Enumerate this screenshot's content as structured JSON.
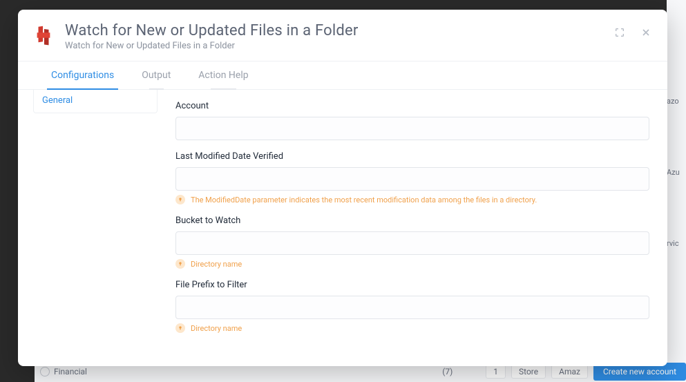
{
  "header": {
    "title": "Watch for New or Updated Files in a Folder",
    "subtitle": "Watch for New or Updated Files in a Folder"
  },
  "tabs": [
    {
      "label": "Configurations",
      "active": true
    },
    {
      "label": "Output",
      "active": false
    },
    {
      "label": "Action Help",
      "active": false
    }
  ],
  "sidebar": {
    "items": [
      {
        "label": "General"
      }
    ]
  },
  "form": {
    "account": {
      "label": "Account",
      "value": ""
    },
    "last_modified": {
      "label": "Last Modified Date Verified",
      "value": "",
      "hint": "The ModifiedDate parameter indicates the most recent modification data among the files in a directory."
    },
    "bucket": {
      "label": "Bucket to Watch",
      "value": "",
      "hint": "Directory name"
    },
    "prefix": {
      "label": "File Prefix to Filter",
      "value": "",
      "hint": "Directory name"
    }
  },
  "background": {
    "right_labels": [
      "azo",
      "Azu",
      "rvic"
    ],
    "bottom": {
      "radio": "Financial",
      "count": "(7)",
      "page": "1",
      "chip1": "Store",
      "chip2": "Amaz",
      "button": "Create new account"
    }
  }
}
